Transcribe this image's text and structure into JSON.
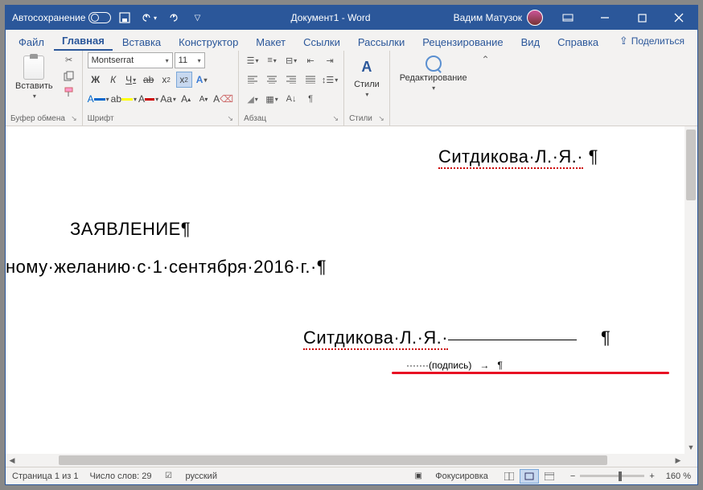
{
  "titlebar": {
    "autosave": "Автосохранение",
    "title": "Документ1 - Word",
    "user": "Вадим Матузок"
  },
  "tabs": {
    "file": "Файл",
    "home": "Главная",
    "insert": "Вставка",
    "design": "Конструктор",
    "layout": "Макет",
    "references": "Ссылки",
    "mailings": "Рассылки",
    "review": "Рецензирование",
    "view": "Вид",
    "help": "Справка",
    "share": "Поделиться"
  },
  "ribbon": {
    "clipboard": {
      "paste": "Вставить",
      "label": "Буфер обмена"
    },
    "font": {
      "family": "Montserrat",
      "size": "11",
      "label": "Шрифт"
    },
    "paragraph": {
      "label": "Абзац"
    },
    "styles": {
      "btn": "Стили",
      "label": "Стили"
    },
    "editing": {
      "btn": "Редактирование"
    }
  },
  "document": {
    "line_author_top": "Ситдикова·Л.·Я.·",
    "heading": "ЗАЯВЛЕНИЕ",
    "body": "ному·желанию·с·1·сентября·2016·г.·",
    "sig_name": "Ситдикова·Л.·Я.·",
    "sig_label": "(подпись)"
  },
  "status": {
    "page": "Страница 1 из 1",
    "words": "Число слов: 29",
    "lang": "русский",
    "focus": "Фокусировка",
    "zoom": "160 %"
  }
}
